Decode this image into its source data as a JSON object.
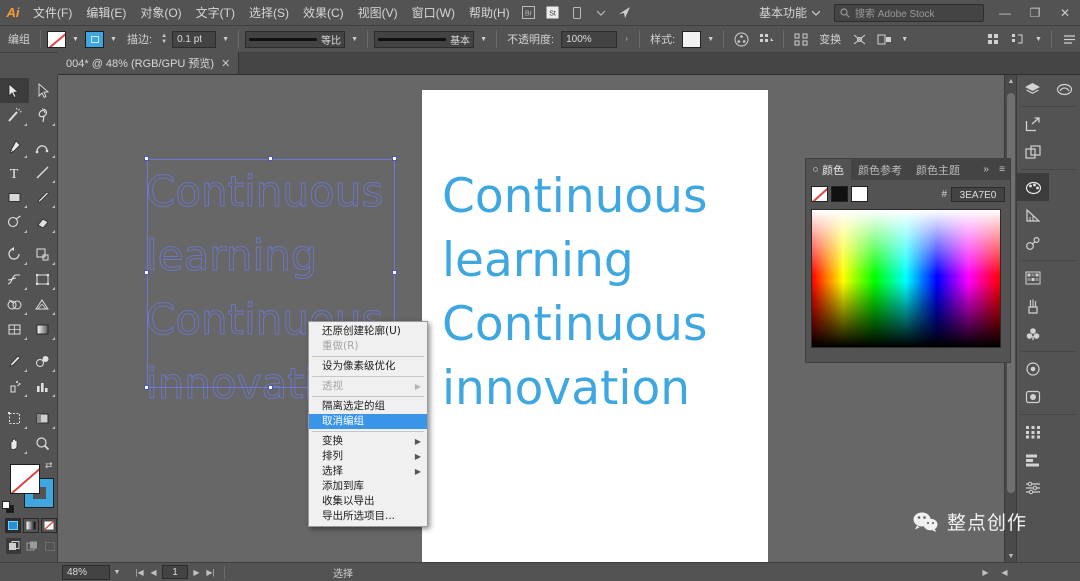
{
  "app": {
    "name": "Adobe Illustrator",
    "logo": "Ai"
  },
  "menubar": {
    "items": [
      {
        "label": "文件(F)"
      },
      {
        "label": "编辑(E)"
      },
      {
        "label": "对象(O)"
      },
      {
        "label": "文字(T)"
      },
      {
        "label": "选择(S)"
      },
      {
        "label": "效果(C)"
      },
      {
        "label": "视图(V)"
      },
      {
        "label": "窗口(W)"
      },
      {
        "label": "帮助(H)"
      }
    ],
    "workspace": "基本功能",
    "search_placeholder": "搜索 Adobe Stock",
    "minimize": "—",
    "restore": "❐",
    "close": "✕"
  },
  "controlbar": {
    "selection_label": "编组",
    "stroke_label": "描边:",
    "stroke_weight": "0.1 pt",
    "stroke_profile": "等比",
    "brush_definition": "基本",
    "opacity_label": "不透明度:",
    "opacity_value": "100%",
    "style_label": "样式:",
    "transform_label": "变换"
  },
  "tabbar": {
    "document": "004* @ 48% (RGB/GPU 预览)",
    "close": "✕"
  },
  "canvas": {
    "artboard_text_lines": [
      "Continuous",
      "learning",
      "Continuous",
      "innovation"
    ],
    "outlined_text_lines": [
      "Continuous",
      "learning",
      "Continuous",
      "innovation"
    ],
    "text_color": "#3EA7E0",
    "selection_color": "#6C79D8"
  },
  "context_menu": {
    "items": [
      {
        "label": "还原创建轮廓(U)",
        "disabled": false,
        "submenu": false,
        "active": false
      },
      {
        "label": "重做(R)",
        "disabled": true,
        "submenu": false,
        "active": false
      },
      {
        "label": "设为像素级优化",
        "disabled": false,
        "submenu": false,
        "active": false
      },
      {
        "label": "透视",
        "disabled": true,
        "submenu": true,
        "active": false
      },
      {
        "label": "隔离选定的组",
        "disabled": false,
        "submenu": false,
        "active": false
      },
      {
        "label": "取消编组",
        "disabled": false,
        "submenu": false,
        "active": true
      },
      {
        "label": "变换",
        "disabled": false,
        "submenu": true,
        "active": false
      },
      {
        "label": "排列",
        "disabled": false,
        "submenu": true,
        "active": false
      },
      {
        "label": "选择",
        "disabled": false,
        "submenu": true,
        "active": false
      },
      {
        "label": "添加到库",
        "disabled": false,
        "submenu": false,
        "active": false
      },
      {
        "label": "收集以导出",
        "disabled": false,
        "submenu": false,
        "active": false
      },
      {
        "label": "导出所选项目...",
        "disabled": false,
        "submenu": false,
        "active": false
      }
    ],
    "highlight_color": "#3A94E8"
  },
  "color_panel": {
    "tabs": [
      {
        "label": "颜色",
        "active": true
      },
      {
        "label": "颜色参考",
        "active": false
      },
      {
        "label": "颜色主题",
        "active": false
      }
    ],
    "hash": "#",
    "hex_value": "3EA7E0",
    "expand": "»",
    "menu": "≡"
  },
  "statusbar": {
    "zoom": "48%",
    "page": "1",
    "status_text": "选择"
  },
  "watermark": {
    "text": "整点创作",
    "icon": "wechat-icon"
  },
  "toolbar": {
    "tools": [
      "selection-tool",
      "direct-selection-tool",
      "magic-wand-tool",
      "lasso-tool",
      "pen-tool",
      "curvature-tool",
      "type-tool",
      "line-segment-tool",
      "rectangle-tool",
      "paintbrush-tool",
      "shaper-tool",
      "eraser-tool",
      "rotate-tool",
      "scale-tool",
      "width-tool",
      "free-transform-tool",
      "shape-builder-tool",
      "perspective-grid-tool",
      "mesh-tool",
      "gradient-tool",
      "eyedropper-tool",
      "blend-tool",
      "symbol-sprayer-tool",
      "column-graph-tool",
      "artboard-tool",
      "slice-tool",
      "hand-tool",
      "zoom-tool"
    ]
  }
}
